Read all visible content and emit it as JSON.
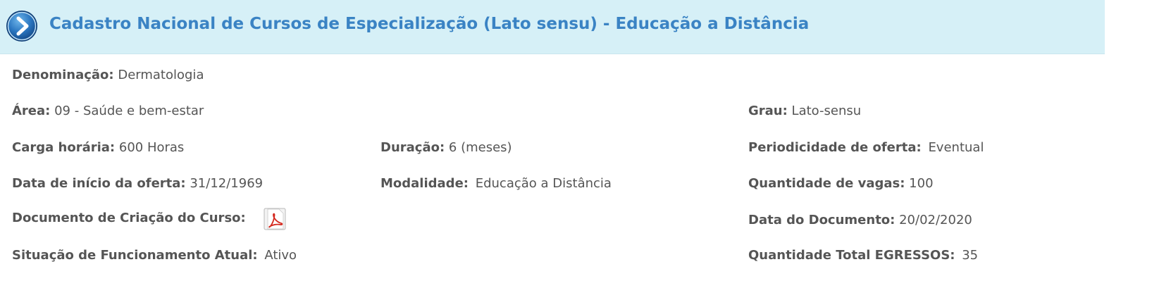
{
  "header": {
    "title": "Cadastro Nacional de Cursos de Especialização (Lato sensu) - Educação a Distância",
    "icon": "arrow-right-circle-icon"
  },
  "fields": {
    "denominacao": {
      "label": "Denominação:",
      "value": "Dermatologia"
    },
    "area": {
      "label": "Área:",
      "value": "09 - Saúde e bem-estar"
    },
    "grau": {
      "label": "Grau:",
      "value": "Lato-sensu"
    },
    "carga_horaria": {
      "label": "Carga horária:",
      "value": "600 Horas"
    },
    "duracao": {
      "label": "Duração:",
      "value": "6 (meses)"
    },
    "periodicidade": {
      "label": "Periodicidade de oferta:",
      "value": "Eventual"
    },
    "data_inicio": {
      "label": "Data de início da oferta:",
      "value": "31/12/1969"
    },
    "modalidade": {
      "label": "Modalidade:",
      "value": "Educação a Distância"
    },
    "quantidade_vagas": {
      "label": "Quantidade de vagas:",
      "value": "100"
    },
    "documento_criacao": {
      "label": "Documento de Criação do Curso:",
      "icon": "pdf-icon"
    },
    "data_documento": {
      "label": "Data do Documento:",
      "value": "20/02/2020"
    },
    "situacao": {
      "label": "Situação de Funcionamento Atual:",
      "value": "Ativo"
    },
    "quantidade_egressos": {
      "label": "Quantidade Total EGRESSOS:",
      "value": "35"
    }
  },
  "colors": {
    "header_bg": "#d6f0f7",
    "title": "#3a83c4",
    "text": "#555555",
    "pdf_red": "#d42a20"
  }
}
